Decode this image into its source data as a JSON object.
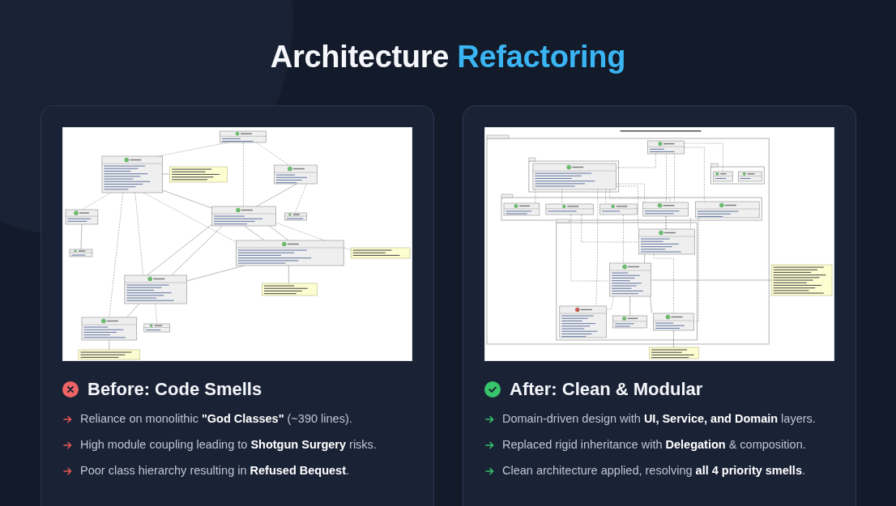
{
  "title": {
    "lead": "Architecture",
    "accent": "Refactoring"
  },
  "panels": [
    {
      "kind": "before",
      "heading": "Before: Code Smells",
      "bullets": [
        "Reliance on monolithic **\"God Classes\"** (~390 lines).",
        "High module coupling leading to **Shotgun Surgery** risks.",
        "Poor class hierarchy resulting in **Refused Bequest**."
      ]
    },
    {
      "kind": "after",
      "heading": "After: Clean & Modular",
      "bullets": [
        "Domain-driven design with **UI, Service, and Domain** layers.",
        "Replaced rigid inheritance with **Delegation** & composition.",
        "Clean architecture applied, resolving **all 4 priority smells**."
      ]
    }
  ]
}
